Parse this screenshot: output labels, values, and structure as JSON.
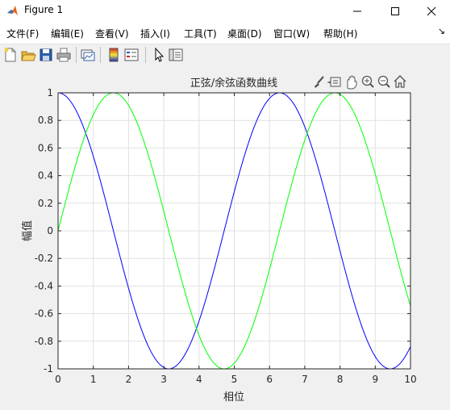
{
  "window": {
    "title": "Figure 1",
    "controls": [
      "minimize",
      "maximize",
      "close"
    ]
  },
  "menu": {
    "items": [
      {
        "label": "文件(F)"
      },
      {
        "label": "编辑(E)"
      },
      {
        "label": "查看(V)"
      },
      {
        "label": "插入(I)"
      },
      {
        "label": "工具(T)"
      },
      {
        "label": "桌面(D)"
      },
      {
        "label": "窗口(W)"
      },
      {
        "label": "帮助(H)"
      }
    ],
    "dock_arrow": "↘"
  },
  "toolbar": {
    "buttons": [
      "new-figure-icon",
      "open-file-icon",
      "save-icon",
      "print-icon",
      "link-plot-icon",
      "colorbar-icon",
      "legend-icon",
      "pointer-icon",
      "property-editor-icon"
    ]
  },
  "axes_toolbar": {
    "buttons": [
      "brush-icon",
      "data-tip-icon",
      "pan-icon",
      "zoom-in-icon",
      "zoom-out-icon",
      "home-icon"
    ]
  },
  "colors": {
    "sine": "#00ff00",
    "cosine": "#0000ff",
    "grid": "#e1e1e1",
    "figure_bg": "#f0f0f0"
  },
  "chart_data": {
    "type": "line",
    "title": "正弦/余弦函数曲线",
    "xlabel": "相位",
    "ylabel": "幅值",
    "xlim": [
      0,
      10
    ],
    "ylim": [
      -1,
      1
    ],
    "grid": true,
    "xticks": [
      "0",
      "1",
      "2",
      "3",
      "4",
      "5",
      "6",
      "7",
      "8",
      "9",
      "10"
    ],
    "yticks": [
      "-1",
      "-0.8",
      "-0.6",
      "-0.4",
      "-0.2",
      "0",
      "0.2",
      "0.4",
      "0.6",
      "0.8",
      "1"
    ],
    "series": [
      {
        "function": "cos",
        "color": "#0000ff",
        "x": [
          0,
          0.5,
          1,
          1.5,
          2,
          2.5,
          3,
          3.5,
          4,
          4.5,
          5,
          5.5,
          6,
          6.5,
          7,
          7.5,
          8,
          8.5,
          9,
          9.5,
          10
        ],
        "y": [
          1,
          0.878,
          0.54,
          0.071,
          -0.416,
          -0.801,
          -0.99,
          -0.936,
          -0.654,
          -0.211,
          0.284,
          0.709,
          0.96,
          0.977,
          0.754,
          0.347,
          -0.146,
          -0.602,
          -0.911,
          -0.997,
          -0.839
        ]
      },
      {
        "function": "sin",
        "color": "#00ff00",
        "x": [
          0,
          0.5,
          1,
          1.5,
          2,
          2.5,
          3,
          3.5,
          4,
          4.5,
          5,
          5.5,
          6,
          6.5,
          7,
          7.5,
          8,
          8.5,
          9,
          9.5,
          10
        ],
        "y": [
          0,
          0.479,
          0.841,
          0.997,
          0.909,
          0.598,
          0.141,
          -0.351,
          -0.757,
          -0.978,
          -0.959,
          -0.706,
          -0.279,
          0.215,
          0.657,
          0.938,
          0.989,
          0.798,
          0.412,
          -0.075,
          -0.544
        ]
      }
    ]
  }
}
